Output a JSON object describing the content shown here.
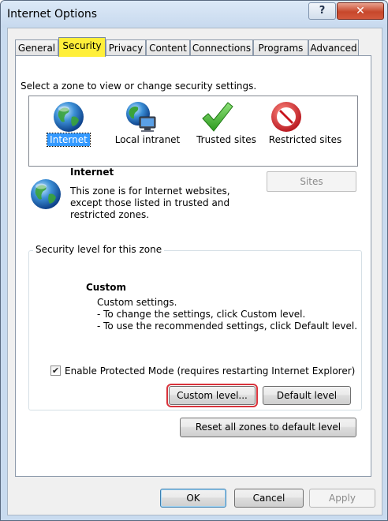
{
  "window": {
    "title": "Internet Options",
    "help_label": "?",
    "close_label": "✕"
  },
  "tabs": [
    {
      "label": "General"
    },
    {
      "label": "Security"
    },
    {
      "label": "Privacy"
    },
    {
      "label": "Content"
    },
    {
      "label": "Connections"
    },
    {
      "label": "Programs"
    },
    {
      "label": "Advanced"
    }
  ],
  "zones": {
    "prompt": "Select a zone to view or change security settings.",
    "items": [
      {
        "label": "Internet",
        "icon": "globe-icon",
        "selected": true
      },
      {
        "label": "Local intranet",
        "icon": "intranet-icon",
        "selected": false
      },
      {
        "label": "Trusted sites",
        "icon": "checkmark-icon",
        "selected": false
      },
      {
        "label": "Restricted sites",
        "icon": "no-entry-icon",
        "selected": false
      }
    ]
  },
  "zone_info": {
    "title": "Internet",
    "description": "This zone is for Internet websites,\nexcept those listed in trusted and\nrestricted zones.",
    "sites_label": "Sites"
  },
  "security_level": {
    "group_label": "Security level for this zone",
    "level_title": "Custom",
    "lines": [
      "Custom settings.",
      "- To change the settings, click Custom level.",
      "- To use the recommended settings, click Default level."
    ],
    "protected_mode_label": "Enable Protected Mode (requires restarting Internet Explorer)",
    "protected_mode_checked": true,
    "custom_level_label": "Custom level...",
    "default_level_label": "Default level"
  },
  "reset_all_label": "Reset all zones to default level",
  "footer": {
    "ok_label": "OK",
    "cancel_label": "Cancel",
    "apply_label": "Apply"
  },
  "colors": {
    "active_tab": "#ffef3a",
    "selection": "#3399ff",
    "highlight_outline": "#d9333c"
  }
}
